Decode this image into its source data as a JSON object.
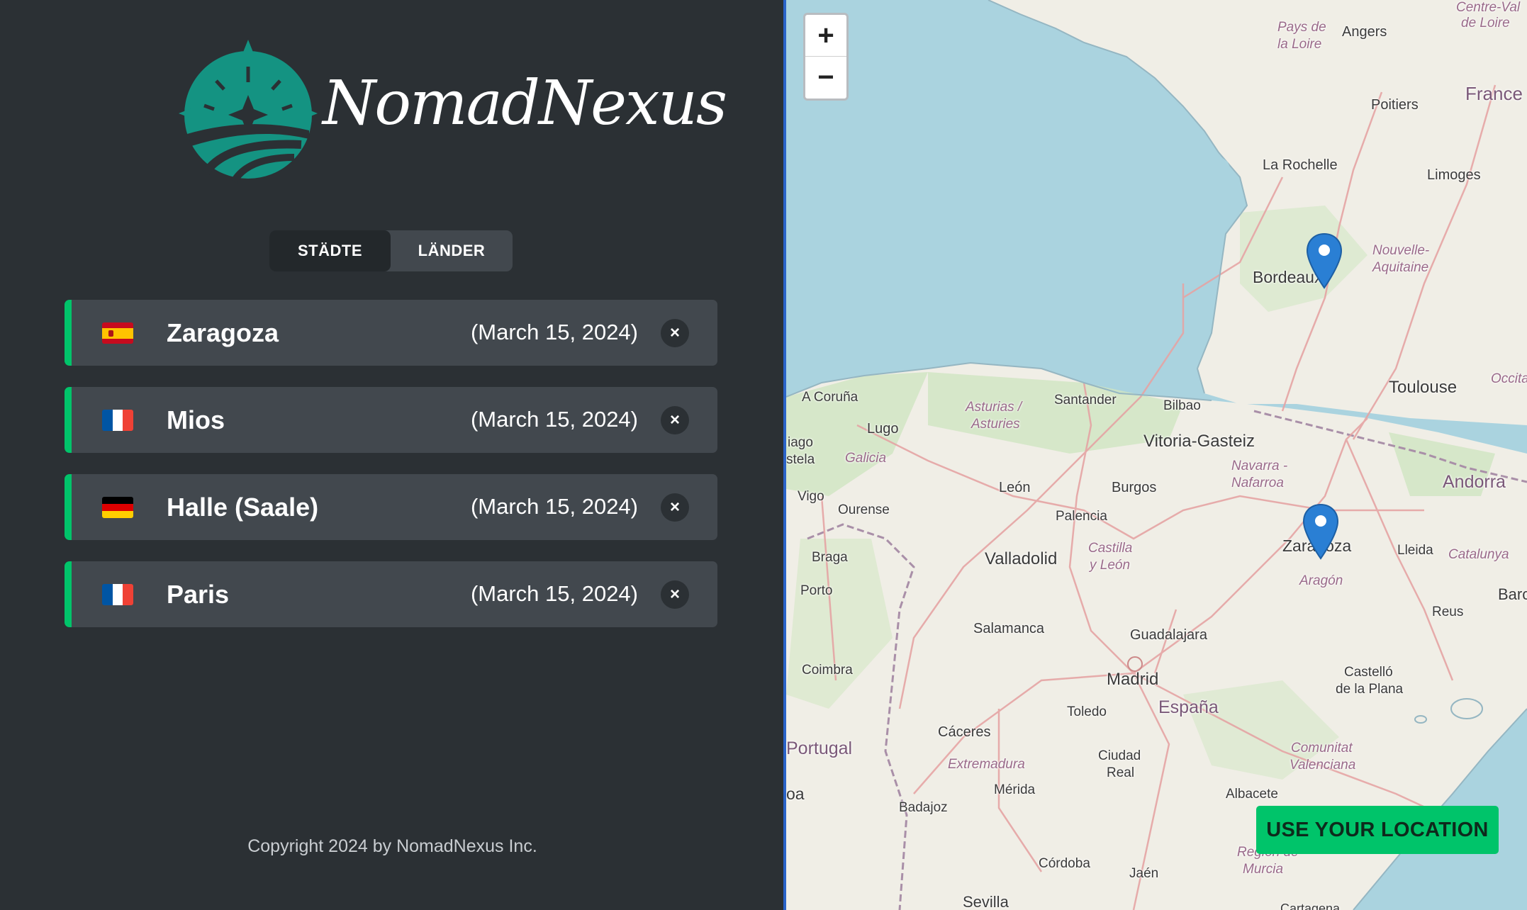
{
  "brand": {
    "name": "NomadNexus",
    "color": "#149382"
  },
  "tabs": [
    {
      "label": "STÄDTE",
      "active": true
    },
    {
      "label": "LÄNDER",
      "active": false
    }
  ],
  "cities": [
    {
      "name": "Zaragoza",
      "date": "(March 15, 2024)",
      "flag": "spain-flag-icon",
      "remove_label": "×"
    },
    {
      "name": "Mios",
      "date": "(March 15, 2024)",
      "flag": "france-flag-icon",
      "remove_label": "×"
    },
    {
      "name": "Halle (Saale)",
      "date": "(March 15, 2024)",
      "flag": "germany-flag-icon",
      "remove_label": "×"
    },
    {
      "name": "Paris",
      "date": "(March 15, 2024)",
      "flag": "france-flag-icon",
      "remove_label": "×"
    }
  ],
  "footer": {
    "copyright": "Copyright 2024 by NomadNexus Inc."
  },
  "map": {
    "zoom_in_label": "+",
    "zoom_out_label": "−",
    "use_location_label": "USE YOUR LOCATION",
    "labels": {
      "pays_de_la_loire_1": "Pays de",
      "pays_de_la_loire_2": "la Loire",
      "angers": "Angers",
      "centre_1": "Centre-Val",
      "centre_2": "de Loire",
      "poitiers": "Poitiers",
      "france": "France",
      "la_rochelle": "La Rochelle",
      "limoges": "Limoges",
      "bordeaux": "Bordeaux",
      "nouvelle_1": "Nouvelle-",
      "nouvelle_2": "Aquitaine",
      "toulouse": "Toulouse",
      "occitanie": "Occitanie",
      "a_coruna": "A Coruña",
      "lugo": "Lugo",
      "asturias_1": "Asturias /",
      "asturias_2": "Asturies",
      "santander": "Santander",
      "bilbao": "Bilbao",
      "santiago_1": "iago",
      "santiago_2": "stela",
      "galicia": "Galicia",
      "vitoria": "Vitoria-Gasteiz",
      "navarra_1": "Navarra -",
      "navarra_2": "Nafarroa",
      "andorra": "Andorra",
      "leon": "León",
      "burgos": "Burgos",
      "vigo": "Vigo",
      "ourense": "Ourense",
      "palencia": "Palencia",
      "castilla_1": "Castilla",
      "castilla_2": "y León",
      "zaragoza": "Zaragoza",
      "lleida": "Lleida",
      "catalunya": "Catalunya",
      "braga": "Braga",
      "valladolid": "Valladolid",
      "aragon": "Aragón",
      "porto": "Porto",
      "barcelona": "Barcel",
      "reus": "Reus",
      "salamanca": "Salamanca",
      "guadalajara": "Guadalajara",
      "coimbra": "Coimbra",
      "madrid": "Madrid",
      "castello_1": "Castelló",
      "castello_2": "de la Plana",
      "toledo": "Toledo",
      "espana": "España",
      "caceres": "Cáceres",
      "portugal": "Portugal",
      "extremadura": "Extremadura",
      "ciudad_real_1": "Ciudad",
      "ciudad_real_2": "Real",
      "comunitat_1": "Comunitat",
      "comunitat_2": "Valenciana",
      "lisboa": "oa",
      "merida": "Mérida",
      "albacete": "Albacete",
      "badajoz": "Badajoz",
      "region_murcia_1": "Región de",
      "region_murcia_2": "Murcia",
      "cordoba": "Córdoba",
      "jaen": "Jaén",
      "sevilla": "Sevilla",
      "cartagena": "Cartagena"
    }
  }
}
